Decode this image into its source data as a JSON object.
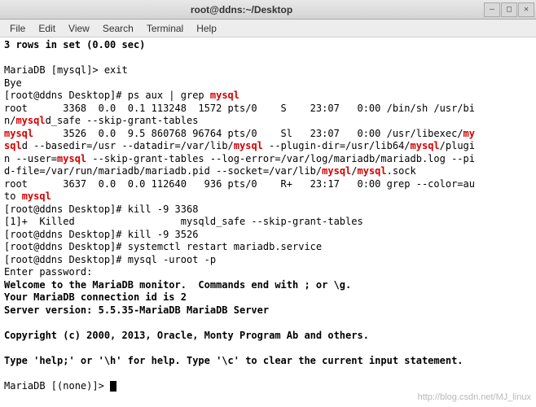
{
  "window": {
    "title": "root@ddns:~/Desktop"
  },
  "menu": {
    "file": "File",
    "edit": "Edit",
    "view": "View",
    "search": "Search",
    "terminal": "Terminal",
    "help": "Help"
  },
  "t": {
    "l1": "3 rows in set (0.00 sec)",
    "l2": "",
    "l3": "MariaDB [mysql]> exit",
    "l4": "Bye",
    "l5a": "[root@ddns Desktop]# ps aux | grep ",
    "l5b": "mysql",
    "l6": "root      3368  0.0  0.1 113248  1572 pts/0    S    23:07   0:00 /bin/sh /usr/bi",
    "l7a": "n/",
    "l7b": "mysql",
    "l7c": "d_safe --skip-grant-tables",
    "l8a": "mysql",
    "l8b": "     3526  0.0  9.5 860768 96764 pts/0    Sl   23:07   0:00 /usr/libexec/",
    "l8c": "my",
    "l9a": "sql",
    "l9b": "d --basedir=/usr --datadir=/var/lib/",
    "l9c": "mysql",
    "l9d": " --plugin-dir=/usr/lib64/",
    "l9e": "mysql",
    "l9f": "/plugi",
    "l10a": "n --user=",
    "l10b": "mysql",
    "l10c": " --skip-grant-tables --log-error=/var/log/mariadb/mariadb.log --pi",
    "l11a": "d-file=/var/run/mariadb/mariadb.pid --socket=/var/lib/",
    "l11b": "mysql",
    "l11c": "/",
    "l11d": "mysql",
    "l11e": ".sock",
    "l12": "root      3637  0.0  0.0 112640   936 pts/0    R+   23:17   0:00 grep --color=au",
    "l13a": "to ",
    "l13b": "mysql",
    "l14": "[root@ddns Desktop]# kill -9 3368",
    "l15": "[1]+  Killed                  mysqld_safe --skip-grant-tables",
    "l16": "[root@ddns Desktop]# kill -9 3526",
    "l17": "[root@ddns Desktop]# systemctl restart mariadb.service",
    "l18": "[root@ddns Desktop]# mysql -uroot -p",
    "l19": "Enter password: ",
    "l20": "Welcome to the MariaDB monitor.  Commands end with ; or \\g.",
    "l21": "Your MariaDB connection id is 2",
    "l22": "Server version: 5.5.35-MariaDB MariaDB Server",
    "l23": "",
    "l24": "Copyright (c) 2000, 2013, Oracle, Monty Program Ab and others.",
    "l25": "",
    "l26": "Type 'help;' or '\\h' for help. Type '\\c' to clear the current input statement.",
    "l27": "",
    "l28": "MariaDB [(none)]> "
  },
  "watermark": "http://blog.csdn.net/MJ_linux"
}
